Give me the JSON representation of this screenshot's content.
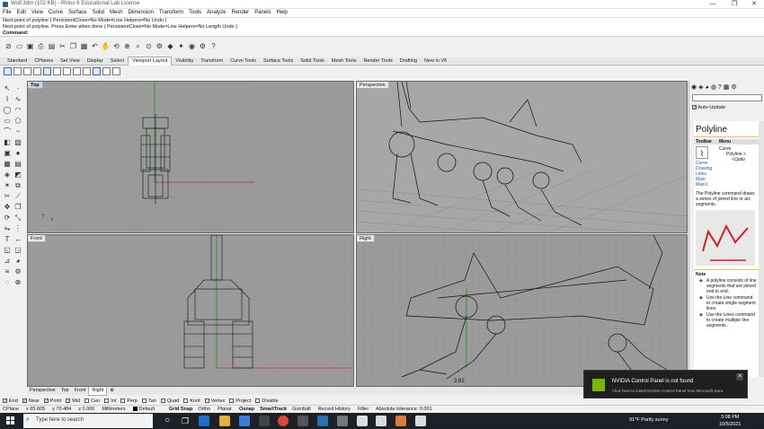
{
  "window": {
    "title": "Wolf.3dm (102 KB) - Rhino 6 Educational Lab License",
    "controls": [
      "—",
      "❐",
      "✕"
    ]
  },
  "menu": [
    "File",
    "Edit",
    "View",
    "Curve",
    "Surface",
    "Solid",
    "Mesh",
    "Dimension",
    "Transform",
    "Tools",
    "Analyze",
    "Render",
    "Panels",
    "Help"
  ],
  "command_history": {
    "line1": "Next point of polyline ( PersistentClose=No  Mode=Line  Helpers=No  Undo )",
    "line2": "Next point of polyline. Press Enter when done ( PersistentClose=No  Mode=Line  Helpers=No  Length  Undo )",
    "prompt": "Command:"
  },
  "toolbar_tabs": [
    "Standard",
    "CPlanes",
    "Set View",
    "Display",
    "Select",
    "Viewport Layout",
    "Visibility",
    "Transform",
    "Curve Tools",
    "Surface Tools",
    "Solid Tools",
    "Mesh Tools",
    "Render Tools",
    "Drafting",
    "New in V6"
  ],
  "active_tab": "Viewport Layout",
  "viewports": {
    "top": "Top",
    "perspective": "Perspective",
    "front": "Front",
    "right": "Right"
  },
  "viewport_tabs": [
    "Perspective",
    "Top",
    "Front",
    "Right"
  ],
  "active_viewport_tab": "Right",
  "osnap": [
    {
      "label": "End",
      "checked": true
    },
    {
      "label": "Near",
      "checked": true
    },
    {
      "label": "Point",
      "checked": true
    },
    {
      "label": "Mid",
      "checked": true
    },
    {
      "label": "Cen",
      "checked": false
    },
    {
      "label": "Int",
      "checked": false
    },
    {
      "label": "Perp",
      "checked": false
    },
    {
      "label": "Tan",
      "checked": false
    },
    {
      "label": "Quad",
      "checked": false
    },
    {
      "label": "Knot",
      "checked": false
    },
    {
      "label": "Vertex",
      "checked": false
    },
    {
      "label": "Project",
      "checked": false
    },
    {
      "label": "Disable",
      "checked": false
    }
  ],
  "status": {
    "cplane": "CPlane",
    "x": "x 65.605",
    "y": "y 70.484",
    "z": "z 0.000",
    "units": "Millimeters",
    "layer": "Default",
    "toggles": [
      "Grid Snap",
      "Ortho",
      "Planar",
      "Osnap",
      "SmartTrack",
      "Gumball",
      "Record History",
      "Filter"
    ],
    "tolerance": "Absolute tolerance: 0.001"
  },
  "right_panel": {
    "auto_update": "Auto-Update",
    "heading": "Polyline",
    "table_headers": [
      "Toolbar",
      "Menu"
    ],
    "menu_lines": [
      "Curve",
      "Polyline >",
      "<Optio"
    ],
    "toolbar_links": [
      "Curve",
      "Drawing",
      "Lines",
      "Main",
      "Main1"
    ],
    "description": "The Polyline command draws a series of joined line or arc segments.",
    "note_heading": "Note",
    "notes": [
      "A polyline consists of line segments that are joined end to end.",
      "Use the Line command to create single-segment lines.",
      "Use the Lines command to create multiple line segments."
    ]
  },
  "measurement_label": "3.62",
  "taskbar": {
    "search_placeholder": "Type here to search",
    "weather": "91°F  Partly sunny",
    "time": "3:08 PM",
    "date": "10/5/2021"
  },
  "toast": {
    "title": "NVIDIA Control Panel is not found",
    "body": "Click here to install NVIDIA Control Panel from Microsoft store.",
    "close": "✕"
  },
  "colors": {
    "viewport_bg": "#9b9b9b",
    "grid_line": "#8c8c8c",
    "axis_x": "#b53232",
    "axis_y": "#2a8a2a",
    "taskbar": "#1c2128",
    "nvidia_green": "#76b900"
  }
}
